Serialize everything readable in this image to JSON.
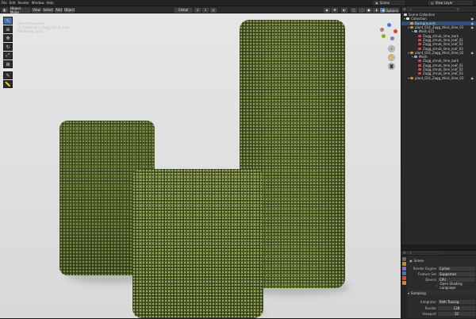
{
  "topbar": {
    "menu": [
      "File",
      "Edit",
      "Render",
      "Window",
      "Help"
    ],
    "scene_label": "Scene",
    "view_layer_label": "View Layer"
  },
  "viewport_header": {
    "mode": "Object Mode",
    "menus": [
      "View",
      "Select",
      "Add",
      "Object"
    ],
    "orientation": "Global",
    "options": "Options"
  },
  "viewport_overlay": {
    "line1": "User Perspective",
    "line2": "(1) Collection | Zagg_shrub_lime",
    "line3": "Rendering Done"
  },
  "outliner": {
    "title": "Scene Collection",
    "rows": [
      {
        "label": "Collection",
        "indent": 0,
        "icon": "collection-icon",
        "selected": false
      },
      {
        "label": "Backgrounds",
        "indent": 1,
        "icon": "object-icon",
        "selected": true
      },
      {
        "label": "plant_014_Zagg_thick_lime_01",
        "indent": 1,
        "icon": "plant-icon",
        "selected": false
      },
      {
        "label": "Mesh.021",
        "indent": 2,
        "icon": "mesh-icon",
        "selected": false
      },
      {
        "label": "Zagg_shrub_lime_bark",
        "indent": 3,
        "icon": "material-icon",
        "selected": false
      },
      {
        "label": "Zagg_shrub_lime_leaf_01",
        "indent": 3,
        "icon": "material-icon",
        "selected": false
      },
      {
        "label": "Zagg_shrub_lime_leaf_02",
        "indent": 3,
        "icon": "material-icon",
        "selected": false
      },
      {
        "label": "Zagg_shrub_lime_leaf_03",
        "indent": 3,
        "icon": "material-icon",
        "selected": false
      },
      {
        "label": "plant_014_Zagg_thick_lime_02",
        "indent": 1,
        "icon": "plant-icon",
        "selected": false
      },
      {
        "label": "Mesh",
        "indent": 2,
        "icon": "mesh-icon",
        "selected": false
      },
      {
        "label": "Zagg_shrub_lime_bark",
        "indent": 3,
        "icon": "material-icon",
        "selected": false
      },
      {
        "label": "Zagg_shrub_lime_leaf_01",
        "indent": 3,
        "icon": "material-icon",
        "selected": false
      },
      {
        "label": "Zagg_shrub_lime_leaf_02",
        "indent": 3,
        "icon": "material-icon",
        "selected": false
      },
      {
        "label": "Zagg_shrub_lime_leaf_03",
        "indent": 3,
        "icon": "material-icon",
        "selected": false
      },
      {
        "label": "plant_014_Zagg_thick_lime_03",
        "indent": 1,
        "icon": "plant-icon",
        "selected": false
      }
    ]
  },
  "properties": {
    "header": "Scene",
    "rows": [
      {
        "label": "Render Engine",
        "value": "Cycles"
      },
      {
        "label": "Feature Set",
        "value": "Supported"
      },
      {
        "label": "Device",
        "value": "CPU"
      },
      {
        "label": "",
        "value": "Open Shading Language"
      }
    ],
    "sampling_label": "Sampling",
    "integrator_label": "Integrator",
    "integrator_value": "Path Tracing",
    "render_label": "Render",
    "render_value": "128",
    "viewport_label": "Viewport",
    "viewport_value": "32"
  },
  "colors": {
    "accent": "#4772b3",
    "selected_row": "#334d80",
    "axis_x": "#e0403f",
    "axis_y": "#7ab52c",
    "axis_z": "#3d7ae0"
  }
}
